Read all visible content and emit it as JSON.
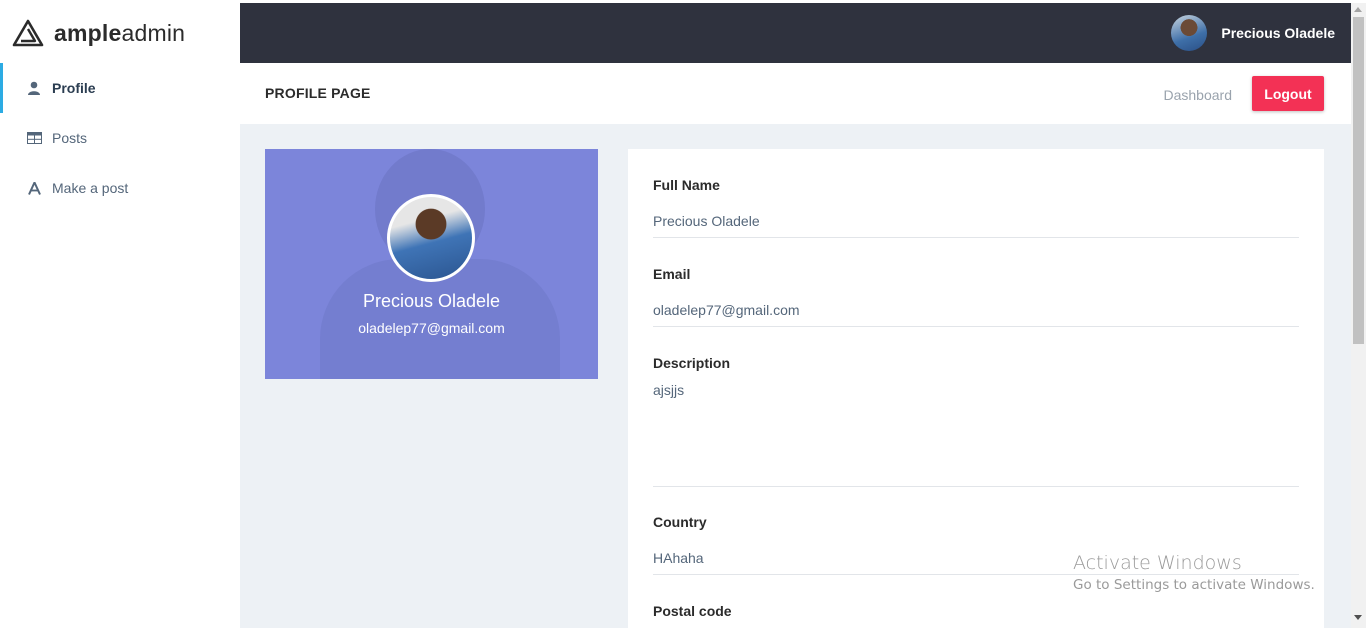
{
  "brand": {
    "bold": "ample",
    "light": "admin",
    "icon": "ample-logo-icon"
  },
  "sidebar": {
    "items": [
      {
        "label": "Profile",
        "icon": "user-icon",
        "active": true
      },
      {
        "label": "Posts",
        "icon": "table-icon",
        "active": false
      },
      {
        "label": "Make a post",
        "icon": "font-a-icon",
        "active": false
      }
    ]
  },
  "topbar": {
    "user_name": "Precious Oladele"
  },
  "header": {
    "page_title": "PROFILE PAGE",
    "breadcrumb": "Dashboard",
    "logout_label": "Logout"
  },
  "profile_card": {
    "name": "Precious Oladele",
    "email": "oladelep77@gmail.com"
  },
  "form": {
    "full_name": {
      "label": "Full Name",
      "value": "Precious Oladele"
    },
    "email": {
      "label": "Email",
      "value": "oladelep77@gmail.com"
    },
    "description": {
      "label": "Description",
      "value": "ajsjjs"
    },
    "country": {
      "label": "Country",
      "value": "HAhaha"
    },
    "postal_code": {
      "label": "Postal code"
    }
  },
  "watermark": {
    "title": "Activate Windows",
    "subtitle": "Go to Settings to activate Windows."
  },
  "colors": {
    "sidebar_accent": "#2cabe3",
    "topbar": "#2f323e",
    "logout": "#f33155",
    "card": "#7c85da",
    "page_bg": "#edf1f5"
  }
}
